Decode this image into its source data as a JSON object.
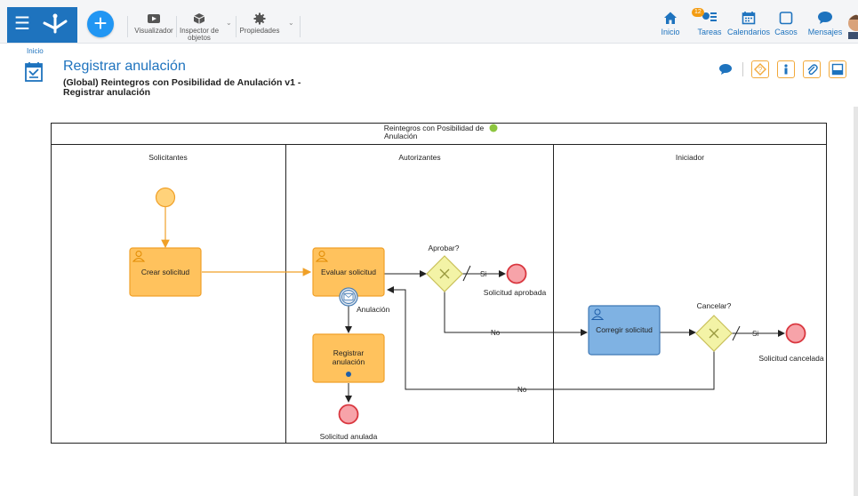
{
  "toolbar": {
    "visualizer_label": "Visualizador",
    "inspector_label_1": "Inspector de",
    "inspector_label_2": "objetos",
    "properties_label": "Propiedades"
  },
  "nav": {
    "inicio": "Inicio",
    "tareas": "Tareas",
    "tareas_badge": "12",
    "calendarios": "Calendarios",
    "casos": "Casos",
    "mensajes": "Mensajes"
  },
  "breadcrumb": "Inicio",
  "page": {
    "title": "Registrar anulación",
    "subtitle_1": "(Global) Reintegros con Posibilidad de Anulación v1 -",
    "subtitle_2": "Registrar anulación"
  },
  "diagram": {
    "pool_title_1": "Reintegros con Posibilidad de",
    "pool_title_2": "Anulación",
    "lanes": [
      "Solicitantes",
      "Autorizantes",
      "Iniciador"
    ],
    "tasks": {
      "crear": "Crear solicitud",
      "evaluar": "Evaluar solicitud",
      "registrar_1": "Registrar",
      "registrar_2": "anulación",
      "corregir": "Corregir solicitud"
    },
    "gateways": {
      "aprobar": "Aprobar?",
      "cancelar": "Cancelar?"
    },
    "events": {
      "aprobada": "Solicitud aprobada",
      "cancelada": "Solicitud cancelada",
      "anulada": "Solicitud anulada",
      "anulacion": "Anulación"
    },
    "flows": {
      "si": "Si",
      "no": "No"
    }
  },
  "colors": {
    "brand": "#1e73be",
    "task_fill": "#ffc25d",
    "task_stroke": "#f0a028",
    "task_blue_fill": "#7fb2e3",
    "gateway_fill": "#f3f3a6",
    "end_fill": "#f7a3a9",
    "start_fill": "#ffd27a"
  }
}
